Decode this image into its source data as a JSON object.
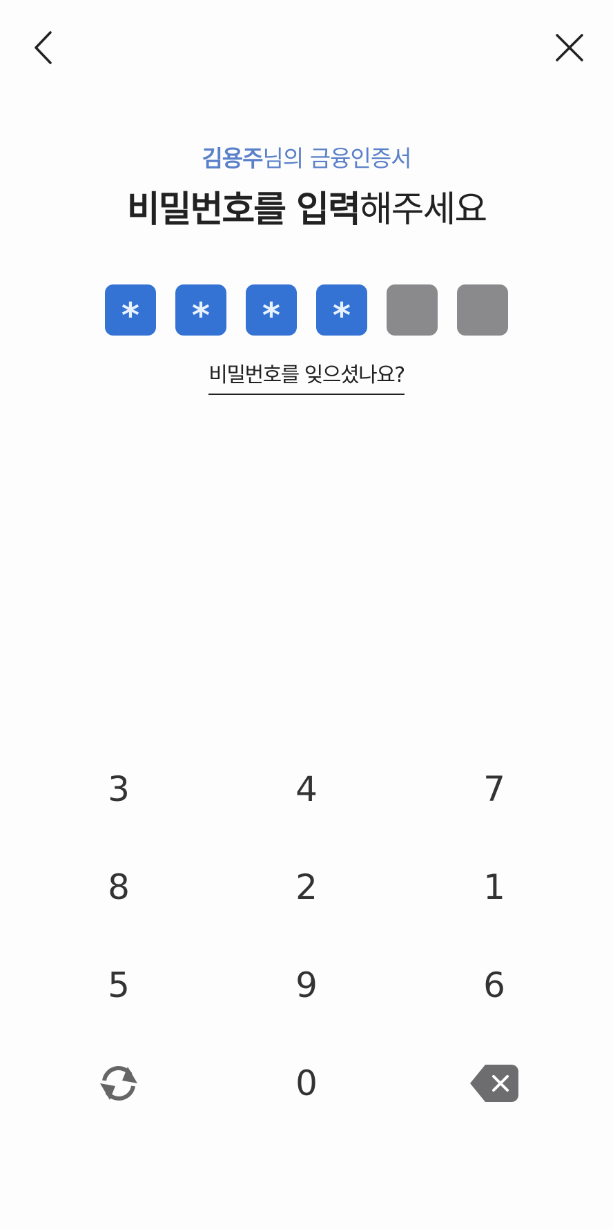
{
  "header": {
    "subtitle_name": "김용주",
    "subtitle_rest": "님의 금융인증서",
    "title_strong": "비밀번호를 입력",
    "title_rest": "해주세요"
  },
  "pin": {
    "length": 6,
    "entered": 4,
    "mask_char": "*",
    "filled_color": "#3473d4",
    "empty_color": "#8a898b"
  },
  "forgot_link": "비밀번호를 잊으셨나요?",
  "keypad": {
    "keys": [
      "3",
      "4",
      "7",
      "8",
      "2",
      "1",
      "5",
      "9",
      "6",
      "0"
    ],
    "shuffle_icon": "refresh-icon",
    "delete_icon": "backspace-icon"
  },
  "icons": {
    "back": "chevron-left-icon",
    "close": "close-icon"
  }
}
